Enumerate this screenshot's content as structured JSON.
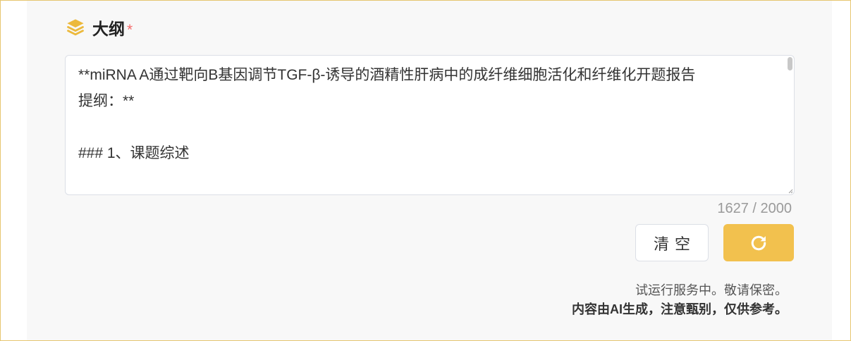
{
  "section": {
    "title": "大纲",
    "required_mark": "*",
    "icon": "layers-icon"
  },
  "editor": {
    "lines": [
      "**miRNA A通过靶向B基因调节TGF-β-诱导的酒精性肝病中的成纤维细胞活化和纤维化开题报告",
      "提纲：**",
      "",
      "### 1、课题综述"
    ],
    "counter": "1627 / 2000"
  },
  "buttons": {
    "clear_label": "清空",
    "refresh_icon": "refresh-icon"
  },
  "notice": {
    "line1": "试运行服务中。敬请保密。",
    "line2": "内容由AI生成，注意甄别，仅供参考。"
  },
  "colors": {
    "accent": "#f2c14e",
    "icon": "#ecb93c",
    "required": "#f56c6c",
    "frame_border": "#e6c670"
  }
}
